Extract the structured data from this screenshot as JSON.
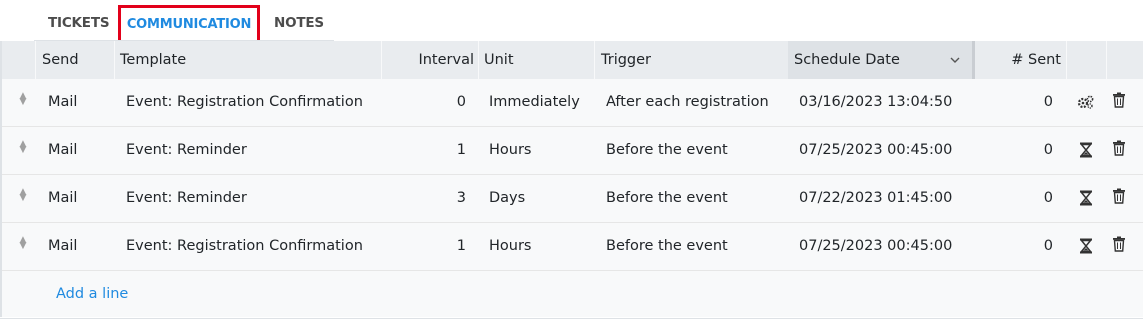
{
  "tabs": [
    {
      "label": "TICKETS"
    },
    {
      "label": "COMMUNICATION"
    },
    {
      "label": "NOTES"
    }
  ],
  "table": {
    "headers": {
      "send": "Send",
      "template": "Template",
      "interval": "Interval",
      "unit": "Unit",
      "trigger": "Trigger",
      "schedule_date": "Schedule Date",
      "sent": "# Sent"
    },
    "rows": [
      {
        "send": "Mail",
        "template": "Event: Registration Confirmation",
        "interval": "0",
        "unit": "Immediately",
        "trigger": "After each registration",
        "schedule_date": "03/16/2023 13:04:50",
        "sent": "0",
        "status_icon": "gears-icon"
      },
      {
        "send": "Mail",
        "template": "Event: Reminder",
        "interval": "1",
        "unit": "Hours",
        "trigger": "Before the event",
        "schedule_date": "07/25/2023 00:45:00",
        "sent": "0",
        "status_icon": "hourglass-icon"
      },
      {
        "send": "Mail",
        "template": "Event: Reminder",
        "interval": "3",
        "unit": "Days",
        "trigger": "Before the event",
        "schedule_date": "07/22/2023 01:45:00",
        "sent": "0",
        "status_icon": "hourglass-icon"
      },
      {
        "send": "Mail",
        "template": "Event: Registration Confirmation",
        "interval": "1",
        "unit": "Hours",
        "trigger": "Before the event",
        "schedule_date": "07/25/2023 00:45:00",
        "sent": "0",
        "status_icon": "hourglass-icon"
      }
    ],
    "add_line": "Add a line"
  },
  "colors": {
    "active_tab": "#1f8ae0",
    "highlight_border": "#e2001a",
    "link": "#1f8ae0"
  }
}
